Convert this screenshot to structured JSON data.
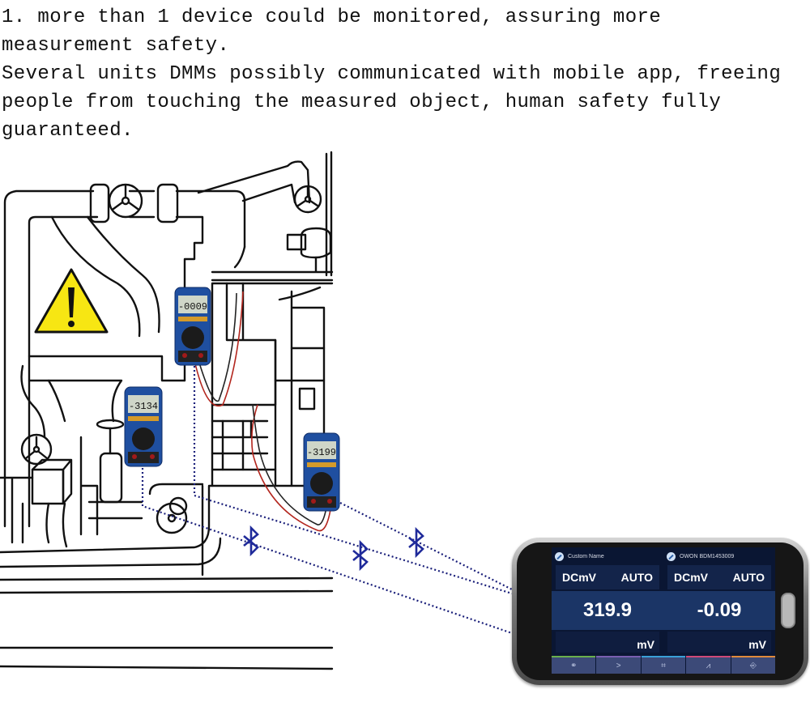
{
  "caption": {
    "lines": [
      "1. more than 1 device could be monitored, assuring more",
      "measurement safety.",
      "Several units DMMs possibly communicated with mobile app, freeing",
      "people from touching the measured object, human safety fully",
      "guaranteed."
    ]
  },
  "illustration": {
    "warning_sign_icon": "warning-triangle-icon",
    "wireless_icon": "bluetooth-icon",
    "multimeters": [
      {
        "display": "-0009",
        "name": "multimeter-1"
      },
      {
        "display": "-3134",
        "name": "multimeter-2"
      },
      {
        "display": "-3199",
        "name": "multimeter-3"
      }
    ],
    "colors": {
      "multimeter_body": "#1f4fa0",
      "signal_dots": "#1a1f7a",
      "warning_yellow": "#f7e613",
      "probe_red": "#b3261e"
    }
  },
  "phone": {
    "panels": [
      {
        "device_name": "Custom Name",
        "mode": "DCmV",
        "range": "AUTO",
        "value": "319.9",
        "unit": "mV"
      },
      {
        "device_name": "OWON BDM1453009",
        "mode": "DCmV",
        "range": "AUTO",
        "value": "-0.09",
        "unit": "mV"
      }
    ],
    "tabs": [
      {
        "icon": "link-icon",
        "glyph": "⚭",
        "accent": "#6ab04c"
      },
      {
        "icon": "chevron-right-icon",
        "glyph": ">",
        "accent": "#7a5fb0"
      },
      {
        "icon": "expand-icon",
        "glyph": "⌗",
        "accent": "#3aa0d8"
      },
      {
        "icon": "chart-icon",
        "glyph": "⩘",
        "accent": "#d04a78"
      },
      {
        "icon": "exit-icon",
        "glyph": "⎆",
        "accent": "#e08a3a"
      }
    ]
  }
}
